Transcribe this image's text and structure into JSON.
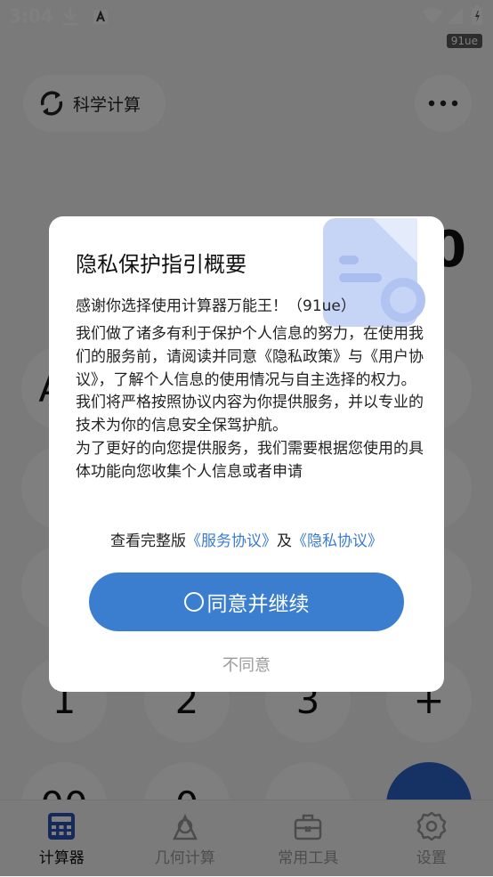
{
  "status_bar": {
    "time": "3:04",
    "tag": "91ue"
  },
  "header": {
    "mode_label": "科学计算",
    "display_value": "0"
  },
  "keypad": {
    "keys": [
      "AC",
      "",
      "",
      "",
      "",
      "",
      "",
      "",
      "",
      "",
      "",
      "",
      "1",
      "2",
      "3",
      "+",
      "00",
      "0",
      "",
      ""
    ]
  },
  "dialog": {
    "title": "隐私保护指引概要",
    "welcome": "感谢你选择使用计算器万能王！（91ue）",
    "paragraphs": [
      "我们做了诸多有利于保护个人信息的努力，在使用我们的服务前，请阅读并同意《隐私政策》与《用户协议》，了解个人信息的使用情况与自主选择的权力。",
      "我们将严格按照协议内容为你提供服务，并以专业的技术为你的信息安全保驾护航。",
      "为了更好的向您提供服务，我们需要根据您使用的具体功能向您收集个人信息或者申请"
    ],
    "links_prefix": "查看完整版",
    "service_link": "《服务协议》",
    "links_and": "及",
    "privacy_link": "《隐私协议》",
    "agree_label": "同意并继续",
    "disagree_label": "不同意"
  },
  "nav": {
    "items": [
      {
        "label": "计算器",
        "icon": "calculator-icon",
        "active": true
      },
      {
        "label": "几何计算",
        "icon": "geometry-icon",
        "active": false
      },
      {
        "label": "常用工具",
        "icon": "toolbox-icon",
        "active": false
      },
      {
        "label": "设置",
        "icon": "gear-icon",
        "active": false
      }
    ]
  },
  "colors": {
    "accent": "#3b7ed0",
    "link": "#3a7bd0",
    "fab": "#2d64c8"
  }
}
